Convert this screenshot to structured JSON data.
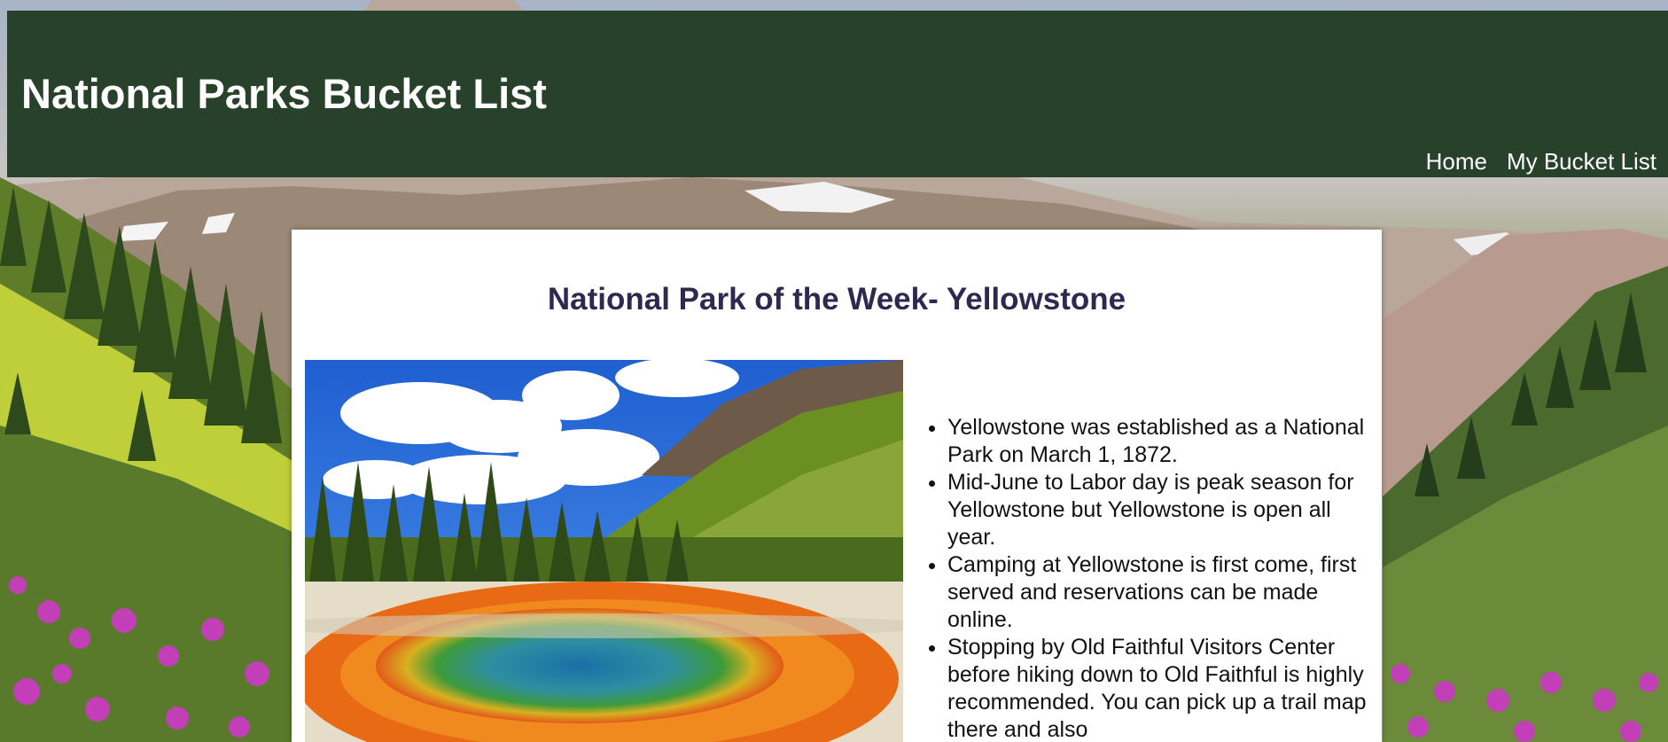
{
  "header": {
    "title": "National Parks Bucket List",
    "background_color": "#27412a"
  },
  "nav": {
    "items": [
      {
        "label": "Home"
      },
      {
        "label": "My Bucket List"
      }
    ]
  },
  "feature": {
    "heading": "National Park of the Week- Yellowstone",
    "heading_color": "#2f2950",
    "facts": [
      "Yellowstone was established as a National Park on March 1, 1872.",
      "Mid-June to Labor day is peak season for Yellowstone but Yellowstone is open all year.",
      "Camping at Yellowstone is first come, first served and reservations can be made online.",
      "Stopping by Old Faithful Visitors Center before hiking down to Old Faithful is highly recommended. You can pick up a trail map there and also"
    ]
  }
}
